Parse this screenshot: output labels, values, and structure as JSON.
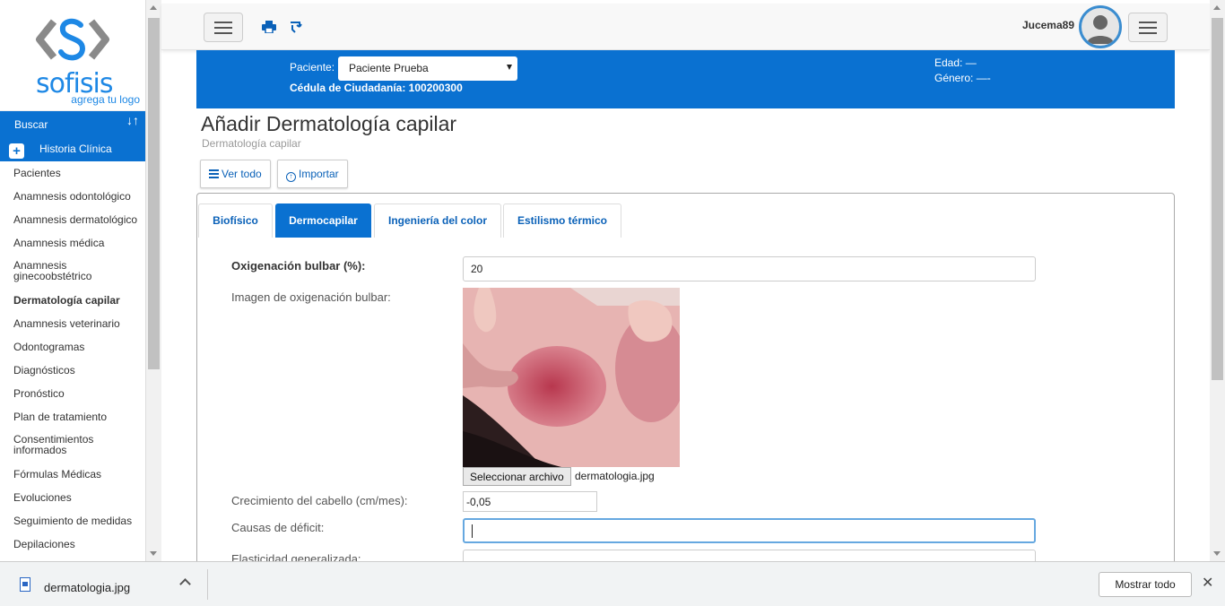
{
  "sidebar": {
    "logo_text": "sofisis",
    "logo_tag": "agrega tu logo",
    "buscar": "Buscar",
    "buscar_sort": "↓↑",
    "historia_clinica": "Historia Clínica",
    "items": [
      {
        "label": "Pacientes"
      },
      {
        "label": "Anamnesis odontológico"
      },
      {
        "label": "Anamnesis dermatológico"
      },
      {
        "label": "Anamnesis médica"
      },
      {
        "label": "Anamnesis ginecoobstétrico"
      },
      {
        "label": "Dermatología capilar"
      },
      {
        "label": "Anamnesis veterinario"
      },
      {
        "label": "Odontogramas"
      },
      {
        "label": "Diagnósticos"
      },
      {
        "label": "Pronóstico"
      },
      {
        "label": "Plan de tratamiento"
      },
      {
        "label": "Consentimientos informados"
      },
      {
        "label": "Fórmulas Médicas"
      },
      {
        "label": "Evoluciones"
      },
      {
        "label": "Seguimiento de medidas"
      },
      {
        "label": "Depilaciones"
      }
    ],
    "active_item": "Dermatología capilar"
  },
  "topbar": {
    "username": "Jucema89"
  },
  "patient": {
    "label": "Paciente:",
    "selected": "Paciente Prueba",
    "cedula": "Cédula de Ciudadanía: 100200300",
    "edad": "Edad: —",
    "genero": "Género: —-"
  },
  "page": {
    "title": "Añadir Dermatología capilar",
    "subtitle": "Dermatología capilar",
    "btn_ver_todo": "Ver todo",
    "btn_importar": "Importar"
  },
  "tabs": [
    {
      "label": "Biofísico",
      "active": false
    },
    {
      "label": "Dermocapilar",
      "active": true
    },
    {
      "label": "Ingeniería del color",
      "active": false
    },
    {
      "label": "Estilismo térmico",
      "active": false
    }
  ],
  "form": {
    "oxigenacion_label": "Oxigenación bulbar (%):",
    "oxigenacion_value": "20",
    "imagen_label": "Imagen de oxigenación bulbar:",
    "file_button": "Seleccionar archivo",
    "file_name": "dermatologia.jpg",
    "crecimiento_label": "Crecimiento del cabello (cm/mes):",
    "crecimiento_value": "-0,05",
    "causas_label": "Causas de déficit:",
    "causas_value": "",
    "elasticidad_label": "Elasticidad generalizada:"
  },
  "downloads": {
    "file_name": "dermatologia.jpg",
    "show_all": "Mostrar todo",
    "close": "✕"
  },
  "colors": {
    "primary": "#0a71d1",
    "link": "#0a61b8",
    "logo": "#1e88e5"
  }
}
